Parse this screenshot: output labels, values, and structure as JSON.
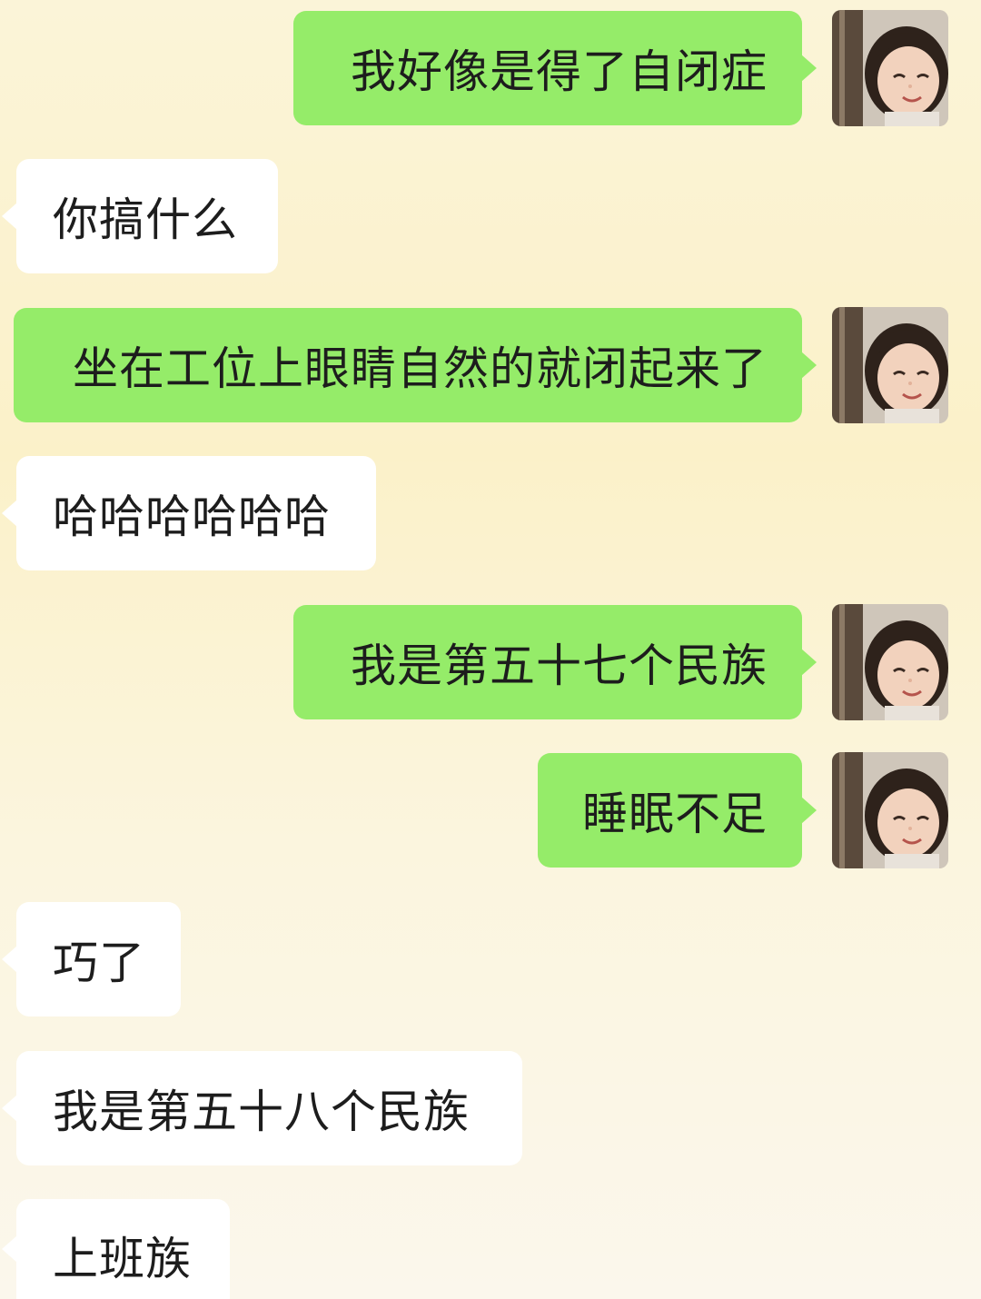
{
  "messages": [
    {
      "side": "sent",
      "text": "我好像是得了自闭症"
    },
    {
      "side": "recv",
      "text": "你搞什么"
    },
    {
      "side": "sent",
      "text": "坐在工位上眼睛自然的就闭起来了"
    },
    {
      "side": "recv",
      "text": "哈哈哈哈哈哈"
    },
    {
      "side": "sent",
      "text": "我是第五十七个民族"
    },
    {
      "side": "sent",
      "text": "睡眠不足"
    },
    {
      "side": "recv",
      "text": "巧了"
    },
    {
      "side": "recv",
      "text": "我是第五十八个民族"
    },
    {
      "side": "recv",
      "text": "上班族"
    }
  ],
  "colors": {
    "sent_bubble": "#95ec69",
    "received_bubble": "#ffffff",
    "background": "#fbf3d2"
  },
  "avatar": {
    "icon": "girl-photo-avatar-icon"
  }
}
